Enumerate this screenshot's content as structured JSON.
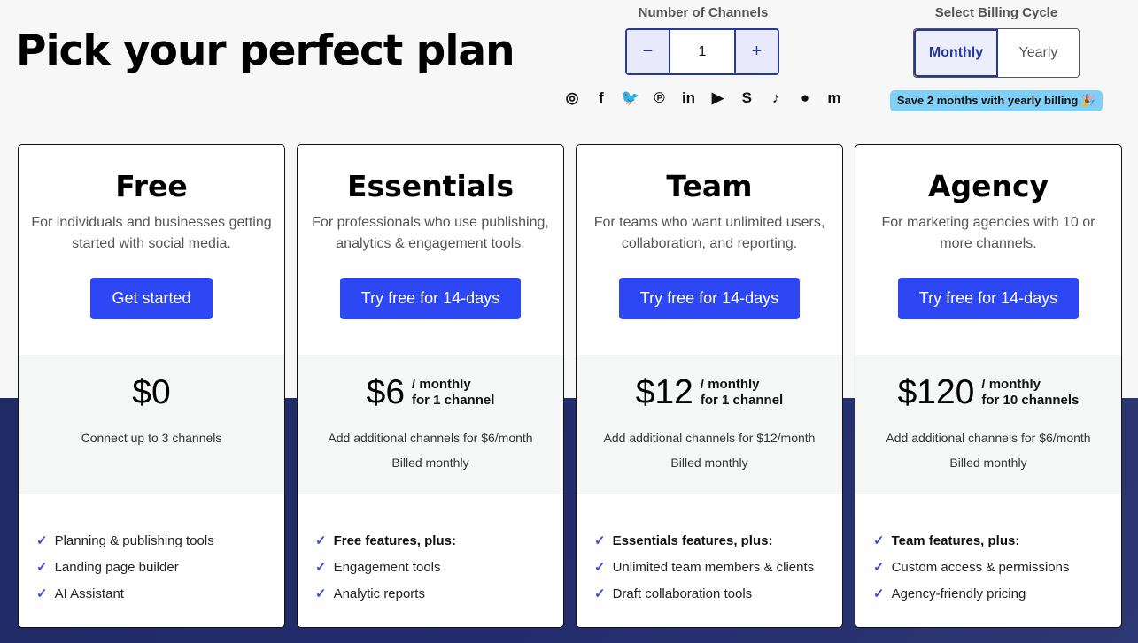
{
  "header": {
    "title": "Pick your perfect plan"
  },
  "channels": {
    "label": "Number of Channels",
    "decrement": "−",
    "increment": "+",
    "value": "1",
    "social_icons": [
      {
        "name": "instagram-icon",
        "glyph": "◎"
      },
      {
        "name": "facebook-icon",
        "glyph": "f"
      },
      {
        "name": "twitter-icon",
        "glyph": "🐦"
      },
      {
        "name": "pinterest-icon",
        "glyph": "℗"
      },
      {
        "name": "linkedin-icon",
        "glyph": "in"
      },
      {
        "name": "youtube-icon",
        "glyph": "▶"
      },
      {
        "name": "shopify-icon",
        "glyph": "S"
      },
      {
        "name": "tiktok-icon",
        "glyph": "♪"
      },
      {
        "name": "google-business-icon",
        "glyph": "●"
      },
      {
        "name": "mastodon-icon",
        "glyph": "m"
      }
    ]
  },
  "billing": {
    "label": "Select Billing Cycle",
    "options": [
      "Monthly",
      "Yearly"
    ],
    "selected": "Monthly",
    "save_badge": "Save 2 months with yearly billing 🎉"
  },
  "plans": [
    {
      "name": "Free",
      "description": "For individuals and businesses getting started with social media.",
      "cta": "Get started",
      "price": "$0",
      "period": "",
      "unit": "",
      "notes": [
        "Connect up to 3 channels"
      ],
      "features": [
        {
          "text": "Planning & publishing tools",
          "bold": false
        },
        {
          "text": "Landing page builder",
          "bold": false
        },
        {
          "text": "AI Assistant",
          "bold": false
        }
      ]
    },
    {
      "name": "Essentials",
      "description": "For professionals who use publishing, analytics & engagement tools.",
      "cta": "Try free for 14-days",
      "price": "$6",
      "period": "/ monthly",
      "unit": "for 1 channel",
      "notes": [
        "Add additional channels for $6/month",
        "Billed monthly"
      ],
      "features": [
        {
          "text": "Free features, plus:",
          "bold": true
        },
        {
          "text": "Engagement tools",
          "bold": false
        },
        {
          "text": "Analytic reports",
          "bold": false
        }
      ]
    },
    {
      "name": "Team",
      "description": "For teams who want unlimited users, collaboration, and reporting.",
      "cta": "Try free for 14-days",
      "price": "$12",
      "period": "/ monthly",
      "unit": "for 1 channel",
      "notes": [
        "Add additional channels for $12/month",
        "Billed monthly"
      ],
      "features": [
        {
          "text": "Essentials features, plus:",
          "bold": true
        },
        {
          "text": "Unlimited team members & clients",
          "bold": false
        },
        {
          "text": "Draft collaboration tools",
          "bold": false
        }
      ]
    },
    {
      "name": "Agency",
      "description": "For marketing agencies with 10 or more channels.",
      "cta": "Try free for 14-days",
      "price": "$120",
      "period": "/ monthly",
      "unit": "for 10 channels",
      "notes": [
        "Add additional channels for $6/month",
        "Billed monthly"
      ],
      "features": [
        {
          "text": "Team features, plus:",
          "bold": true
        },
        {
          "text": "Custom access & permissions",
          "bold": false
        },
        {
          "text": "Agency-friendly pricing",
          "bold": false
        }
      ]
    }
  ],
  "colors": {
    "accent": "#2e47f5",
    "selected": "#26389e",
    "badge": "#7fcff7",
    "band": "#232d6e"
  }
}
